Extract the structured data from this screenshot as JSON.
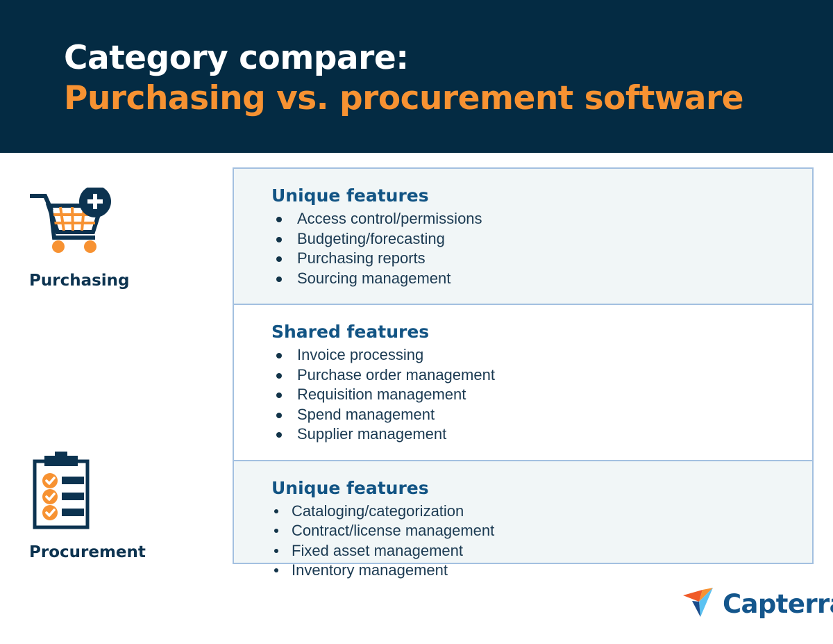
{
  "header": {
    "title_line_1": "Category compare:",
    "title_line_2": "Purchasing vs. procurement software",
    "background_color": "#042B43",
    "line_1_color": "#FFFFFF",
    "line_2_color": "#F79232"
  },
  "categories": [
    {
      "label": "Purchasing",
      "icon": "shopping-cart-plus-icon"
    },
    {
      "label": "Procurement",
      "icon": "clipboard-checklist-icon"
    }
  ],
  "panel": {
    "border_color": "#A3C0E0",
    "tint_background": "#F1F6F7",
    "heading_color": "#125484",
    "sections": [
      {
        "id": "purchasing-unique",
        "heading": "Unique features",
        "items": [
          "Access control/permissions",
          "Budgeting/forecasting",
          "Purchasing reports",
          "Sourcing management"
        ]
      },
      {
        "id": "shared",
        "heading": "Shared features",
        "items": [
          "Invoice processing",
          "Purchase order management",
          "Requisition management",
          "Spend management",
          "Supplier management"
        ]
      },
      {
        "id": "procurement-unique",
        "heading": "Unique features",
        "items": [
          "Cataloging/categorization",
          "Contract/license management",
          "Fixed asset management",
          "Inventory management"
        ]
      }
    ]
  },
  "logo": {
    "wordmark": "Capterra",
    "wordmark_color": "#14568C",
    "mark_colors": {
      "upper_left": "#F05A28",
      "upper_mid": "#F79232",
      "right_wing": "#5BC2F2",
      "lower_point": "#1A4C8B"
    }
  },
  "palette": {
    "navy": "#0C3350",
    "orange": "#F79232",
    "white": "#FFFFFF",
    "body_text": "#1B3A52"
  }
}
